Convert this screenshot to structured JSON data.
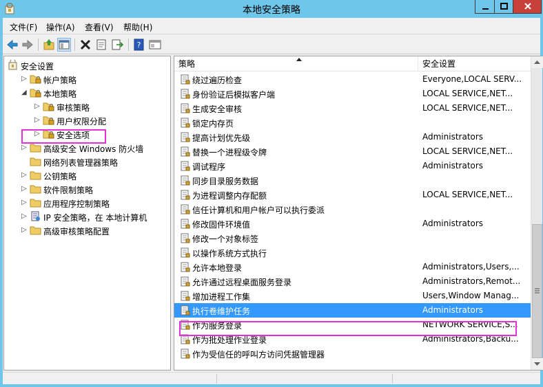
{
  "window": {
    "title": "本地安全策略"
  },
  "menu": [
    "文件(F)",
    "操作(A)",
    "查看(V)",
    "帮助(H)"
  ],
  "toolbar_icons": [
    "back-arrow-icon",
    "forward-arrow-icon",
    "up-folder-icon",
    "show-hide-tree-icon",
    "delete-icon",
    "properties-icon",
    "export-list-icon",
    "help-icon",
    "console-view-icon"
  ],
  "tree": [
    {
      "label": "安全设置",
      "expanded": true
    },
    {
      "label": "帐户策略",
      "expanded": false
    },
    {
      "label": "本地策略",
      "expanded": true
    },
    {
      "label": "审核策略",
      "expanded": false
    },
    {
      "label": "用户权限分配",
      "expanded": false,
      "highlighted": true
    },
    {
      "label": "安全选项",
      "expanded": false
    },
    {
      "label": "高级安全 Windows 防火墙",
      "expanded": false
    },
    {
      "label": "网络列表管理器策略",
      "expanded": null
    },
    {
      "label": "公钥策略",
      "expanded": false
    },
    {
      "label": "软件限制策略",
      "expanded": false
    },
    {
      "label": "应用程序控制策略",
      "expanded": false
    },
    {
      "label": "IP 安全策略，在 本地计算机",
      "expanded": false
    },
    {
      "label": "高级审核策略配置",
      "expanded": false
    }
  ],
  "list": {
    "columns": [
      "策略",
      "安全设置"
    ],
    "rows": [
      {
        "policy": "绕过遍历检查",
        "setting": "Everyone,LOCAL SERV..."
      },
      {
        "policy": "身份验证后模拟客户端",
        "setting": "LOCAL SERVICE,NET..."
      },
      {
        "policy": "生成安全审核",
        "setting": "LOCAL SERVICE,NET..."
      },
      {
        "policy": "锁定内存页",
        "setting": ""
      },
      {
        "policy": "提高计划优先级",
        "setting": "Administrators"
      },
      {
        "policy": "替换一个进程级令牌",
        "setting": "LOCAL SERVICE,NET..."
      },
      {
        "policy": "调试程序",
        "setting": "Administrators"
      },
      {
        "policy": "同步目录服务数据",
        "setting": ""
      },
      {
        "policy": "为进程调整内存配额",
        "setting": "LOCAL SERVICE,NET..."
      },
      {
        "policy": "信任计算机和用户帐户可以执行委派",
        "setting": ""
      },
      {
        "policy": "修改固件环境值",
        "setting": "Administrators"
      },
      {
        "policy": "修改一个对象标签",
        "setting": ""
      },
      {
        "policy": "以操作系统方式执行",
        "setting": ""
      },
      {
        "policy": "允许本地登录",
        "setting": "Administrators,Users,..."
      },
      {
        "policy": "允许通过远程桌面服务登录",
        "setting": "Administrators,Remot..."
      },
      {
        "policy": "增加进程工作集",
        "setting": "Users,Window Manag..."
      },
      {
        "policy": "执行卷维护任务",
        "setting": "Administrators",
        "selected": true
      },
      {
        "policy": "作为服务登录",
        "setting": "NETWORK SERVICE,S..."
      },
      {
        "policy": "作为批处理作业登录",
        "setting": "Administrators,Backu..."
      },
      {
        "policy": "作为受信任的呼叫方访问凭据管理器",
        "setting": ""
      }
    ]
  },
  "colors": {
    "titlebar": "#6ec6ea",
    "selection": "#3399ff",
    "highlight_box": "#e430d8",
    "close_button": "#c7403a"
  }
}
